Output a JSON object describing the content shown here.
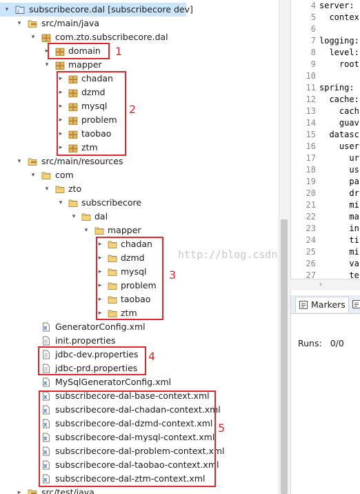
{
  "project_tree": {
    "root": {
      "label": "subscribecore.dal  [subscribecore dev]"
    },
    "src_main_java": {
      "label": "src/main/java"
    },
    "package": {
      "label": "com.zto.subscribecore.dal"
    },
    "domain": {
      "label": "domain"
    },
    "mapper": {
      "label": "mapper"
    },
    "java_mapper_items": [
      "chadan",
      "dzmd",
      "mysql",
      "problem",
      "taobao",
      "ztm"
    ],
    "src_main_resources": {
      "label": "src/main/resources"
    },
    "com": {
      "label": "com"
    },
    "zto": {
      "label": "zto"
    },
    "subscribecore": {
      "label": "subscribecore"
    },
    "dal": {
      "label": "dal"
    },
    "res_mapper": {
      "label": "mapper"
    },
    "res_mapper_items": [
      "chadan",
      "dzmd",
      "mysql",
      "problem",
      "taobao",
      "ztm"
    ],
    "files": [
      "GeneratorConfig.xml",
      "init.properties",
      "jdbc-dev.properties",
      "jdbc-prd.properties",
      "MySqlGeneratorConfig.xml"
    ],
    "context_files": [
      "subscribecore-dal-base-context.xml",
      "subscribecore-dal-chadan-context.xml",
      "subscribecore-dal-dzmd-context.xml",
      "subscribecore-dal-mysql-context.xml",
      "subscribecore-dal-problem-context.xml",
      "subscribecore-dal-taobao-context.xml",
      "subscribecore-dal-ztm-context.xml"
    ],
    "src_test_java": {
      "label": "src/test/java"
    }
  },
  "annotations": [
    "1",
    "2",
    "3",
    "4",
    "5"
  ],
  "editor": {
    "lines": [
      {
        "n": "4",
        "t": "server:"
      },
      {
        "n": "5",
        "t": "  contex"
      },
      {
        "n": "6",
        "t": ""
      },
      {
        "n": "7",
        "t": "logging:"
      },
      {
        "n": "8",
        "t": "  level:"
      },
      {
        "n": "9",
        "t": "    root"
      },
      {
        "n": "10",
        "t": ""
      },
      {
        "n": "11",
        "t": "spring:"
      },
      {
        "n": "12",
        "t": "  cache:"
      },
      {
        "n": "13",
        "t": "    cach"
      },
      {
        "n": "14",
        "t": "    guav"
      },
      {
        "n": "15",
        "t": "  datasc"
      },
      {
        "n": "16",
        "t": "    user"
      },
      {
        "n": "17",
        "t": "      ur"
      },
      {
        "n": "18",
        "t": "      us"
      },
      {
        "n": "19",
        "t": "      pa"
      },
      {
        "n": "20",
        "t": "      dr"
      },
      {
        "n": "21",
        "t": "      mi"
      },
      {
        "n": "22",
        "t": "      ma"
      },
      {
        "n": "23",
        "t": "      in"
      },
      {
        "n": "24",
        "t": "      ti"
      },
      {
        "n": "25",
        "t": "      mi"
      },
      {
        "n": "26",
        "t": "      va"
      },
      {
        "n": "27",
        "t": "      te"
      }
    ]
  },
  "bottom_panel": {
    "tab_label": "Markers",
    "runs_label": "Runs:",
    "runs_value": "0/0"
  },
  "watermark": "http://blog.csdn.net/",
  "colors": {
    "annotation": "#e0262b",
    "selection": "#cde5fb",
    "folder": "#e8c35a",
    "package": "#b5873a"
  }
}
